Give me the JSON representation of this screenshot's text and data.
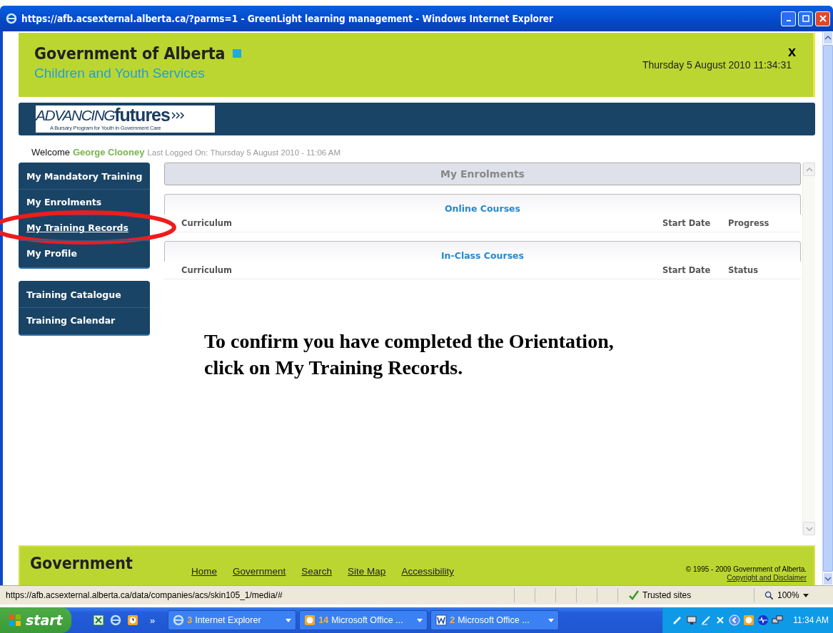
{
  "window": {
    "title": "https://afb.acsexternal.alberta.ca/?parms=1 - GreenLight learning management - Windows Internet Explorer"
  },
  "header": {
    "org": "Government of Alberta",
    "department": "Children and Youth Services",
    "close": "x",
    "datetime": "Thursday 5 August 2010 11:34:31"
  },
  "banner": {
    "logo_word_1": "ADVANCING",
    "logo_word_2": "futures",
    "logo_tagline": "A Bursary Program for Youth in Government Care"
  },
  "welcome": {
    "greeting": "Welcome",
    "user": "George Clooney",
    "last_logged": "Last Logged On: Thursday 5 August 2010 - 11:06 AM"
  },
  "sidebar": {
    "groups": [
      [
        {
          "label": "My Mandatory Training",
          "hovered": false,
          "circled": false
        },
        {
          "label": "My Enrolments",
          "hovered": false,
          "circled": false
        },
        {
          "label": "My Training Records",
          "hovered": true,
          "circled": true
        },
        {
          "label": "My Profile",
          "hovered": false,
          "circled": false
        }
      ],
      [
        {
          "label": "Training Catalogue",
          "hovered": false,
          "circled": false
        },
        {
          "label": "Training Calendar",
          "hovered": false,
          "circled": false
        }
      ]
    ]
  },
  "main": {
    "title": "My Enrolments",
    "sections": [
      {
        "title": "Online Courses",
        "columns": [
          "Curriculum",
          "Start Date",
          "Progress"
        ]
      },
      {
        "title": "In-Class Courses",
        "columns": [
          "Curriculum",
          "Start Date",
          "Status"
        ]
      }
    ],
    "instruction": [
      "To confirm you have completed the Orientation,",
      "click on My Training Records."
    ]
  },
  "footer": {
    "org": "Government",
    "links": [
      "Home",
      "Government",
      "Search",
      "Site Map",
      "Accessibility"
    ],
    "copyright": "© 1995 - 2009 Government of Alberta.",
    "disclaimer": "Copyright and Disclaimer"
  },
  "status_bar": {
    "url": "https://afb.acsexternal.alberta.ca/data/companies/acs/skin105_1/media/#",
    "zone": "Trusted sites",
    "zoom": "100%"
  },
  "taskbar": {
    "start": "start",
    "more": "»",
    "buttons": [
      {
        "count": "3",
        "label": "Internet Explorer",
        "kind": "ie"
      },
      {
        "count": "14",
        "label": "Microsoft Office ...",
        "kind": "outlook"
      },
      {
        "count": "2",
        "label": "Microsoft Office ...",
        "kind": "word"
      }
    ],
    "clock": "11:34 AM"
  }
}
